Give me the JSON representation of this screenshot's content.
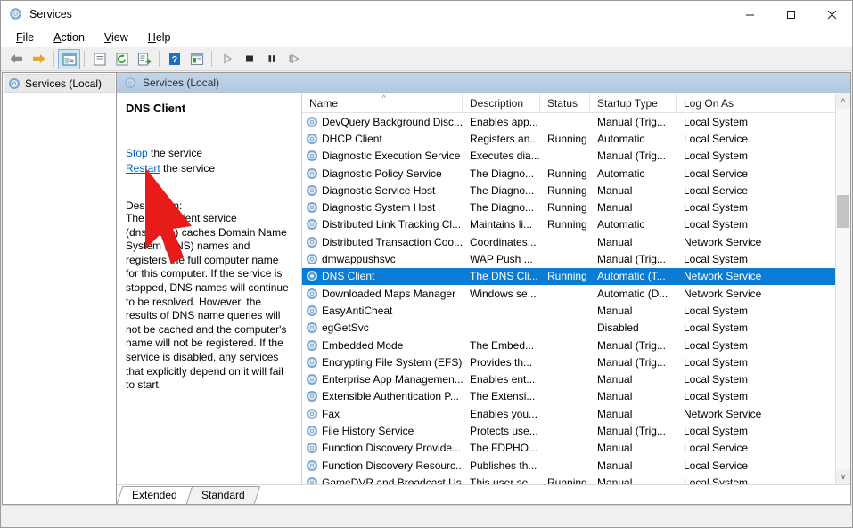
{
  "window": {
    "title": "Services",
    "icon": "services-gear-icon",
    "controls": {
      "minimize": "—",
      "maximize": "☐",
      "close": "✕"
    }
  },
  "menubar": [
    {
      "name": "file",
      "label": "File",
      "accel": "F"
    },
    {
      "name": "action",
      "label": "Action",
      "accel": "A"
    },
    {
      "name": "view",
      "label": "View",
      "accel": "V"
    },
    {
      "name": "help",
      "label": "Help",
      "accel": "H"
    }
  ],
  "toolbar": [
    {
      "name": "back-button",
      "icon": "arrow-left-icon",
      "active": false
    },
    {
      "name": "forward-button",
      "icon": "arrow-right-icon",
      "active": false
    },
    {
      "name": "show-hide-tree-button",
      "icon": "tree-panel-icon",
      "active": true
    },
    {
      "name": "properties-button",
      "icon": "properties-icon",
      "active": false
    },
    {
      "name": "refresh-button",
      "icon": "refresh-icon",
      "active": false
    },
    {
      "name": "export-list-button",
      "icon": "export-icon",
      "active": false
    },
    {
      "name": "help-button",
      "icon": "help-question-icon",
      "active": false
    },
    {
      "name": "console-view-button",
      "icon": "console-view-icon",
      "active": false
    },
    {
      "name": "start-service-button",
      "icon": "play-icon",
      "active": false
    },
    {
      "name": "stop-service-button",
      "icon": "stop-icon",
      "active": false
    },
    {
      "name": "pause-service-button",
      "icon": "pause-icon",
      "active": false
    },
    {
      "name": "restart-service-button",
      "icon": "restart-icon",
      "active": false
    }
  ],
  "tree": {
    "items": [
      {
        "name": "services-local",
        "label": "Services (Local)",
        "icon": "services-gear-icon",
        "selected": true
      }
    ]
  },
  "pane": {
    "header_label": "Services (Local)",
    "header_icon": "services-gear-icon"
  },
  "details": {
    "service_name": "DNS Client",
    "links": [
      {
        "name": "stop-service-link",
        "link_text": "Stop",
        "suffix": " the service"
      },
      {
        "name": "restart-service-link",
        "link_text": "Restart",
        "suffix": " the service"
      }
    ],
    "description_label": "Description:",
    "description_body": "The DNS Client service (dnscache) caches Domain Name System (DNS) names and registers the full computer name for this computer. If the service is stopped, DNS names will continue to be resolved. However, the results of DNS name queries will not be cached and the computer's name will not be registered. If the service is disabled, any services that explicitly depend on it will fail to start."
  },
  "list": {
    "columns": [
      {
        "name": "column-name",
        "label": "Name",
        "sorted": "asc"
      },
      {
        "name": "column-description",
        "label": "Description",
        "sorted": ""
      },
      {
        "name": "column-status",
        "label": "Status",
        "sorted": ""
      },
      {
        "name": "column-startup-type",
        "label": "Startup Type",
        "sorted": ""
      },
      {
        "name": "column-log-on-as",
        "label": "Log On As",
        "sorted": ""
      }
    ],
    "sort_arrow": "^",
    "rows": [
      {
        "name": "DevQuery Background Disc...",
        "description": "Enables app...",
        "status": "",
        "startup": "Manual (Trig...",
        "logon": "Local System",
        "selected": false
      },
      {
        "name": "DHCP Client",
        "description": "Registers an...",
        "status": "Running",
        "startup": "Automatic",
        "logon": "Local Service",
        "selected": false
      },
      {
        "name": "Diagnostic Execution Service",
        "description": "Executes dia...",
        "status": "",
        "startup": "Manual (Trig...",
        "logon": "Local System",
        "selected": false
      },
      {
        "name": "Diagnostic Policy Service",
        "description": "The Diagno...",
        "status": "Running",
        "startup": "Automatic",
        "logon": "Local Service",
        "selected": false
      },
      {
        "name": "Diagnostic Service Host",
        "description": "The Diagno...",
        "status": "Running",
        "startup": "Manual",
        "logon": "Local Service",
        "selected": false
      },
      {
        "name": "Diagnostic System Host",
        "description": "The Diagno...",
        "status": "Running",
        "startup": "Manual",
        "logon": "Local System",
        "selected": false
      },
      {
        "name": "Distributed Link Tracking Cl...",
        "description": "Maintains li...",
        "status": "Running",
        "startup": "Automatic",
        "logon": "Local System",
        "selected": false
      },
      {
        "name": "Distributed Transaction Coo...",
        "description": "Coordinates...",
        "status": "",
        "startup": "Manual",
        "logon": "Network Service",
        "selected": false
      },
      {
        "name": "dmwappushsvc",
        "description": "WAP Push ...",
        "status": "",
        "startup": "Manual (Trig...",
        "logon": "Local System",
        "selected": false
      },
      {
        "name": "DNS Client",
        "description": "The DNS Cli...",
        "status": "Running",
        "startup": "Automatic (T...",
        "logon": "Network Service",
        "selected": true
      },
      {
        "name": "Downloaded Maps Manager",
        "description": "Windows se...",
        "status": "",
        "startup": "Automatic (D...",
        "logon": "Network Service",
        "selected": false
      },
      {
        "name": "EasyAntiCheat",
        "description": "",
        "status": "",
        "startup": "Manual",
        "logon": "Local System",
        "selected": false
      },
      {
        "name": "egGetSvc",
        "description": "",
        "status": "",
        "startup": "Disabled",
        "logon": "Local System",
        "selected": false
      },
      {
        "name": "Embedded Mode",
        "description": "The Embed...",
        "status": "",
        "startup": "Manual (Trig...",
        "logon": "Local System",
        "selected": false
      },
      {
        "name": "Encrypting File System (EFS)",
        "description": "Provides th...",
        "status": "",
        "startup": "Manual (Trig...",
        "logon": "Local System",
        "selected": false
      },
      {
        "name": "Enterprise App Managemen...",
        "description": "Enables ent...",
        "status": "",
        "startup": "Manual",
        "logon": "Local System",
        "selected": false
      },
      {
        "name": "Extensible Authentication P...",
        "description": "The Extensi...",
        "status": "",
        "startup": "Manual",
        "logon": "Local System",
        "selected": false
      },
      {
        "name": "Fax",
        "description": "Enables you...",
        "status": "",
        "startup": "Manual",
        "logon": "Network Service",
        "selected": false
      },
      {
        "name": "File History Service",
        "description": "Protects use...",
        "status": "",
        "startup": "Manual (Trig...",
        "logon": "Local System",
        "selected": false
      },
      {
        "name": "Function Discovery Provide...",
        "description": "The FDPHO...",
        "status": "",
        "startup": "Manual",
        "logon": "Local Service",
        "selected": false
      },
      {
        "name": "Function Discovery Resourc...",
        "description": "Publishes th...",
        "status": "",
        "startup": "Manual",
        "logon": "Local Service",
        "selected": false
      },
      {
        "name": "GameDVR and Broadcast Us...",
        "description": "This user se...",
        "status": "Running",
        "startup": "Manual",
        "logon": "Local System",
        "selected": false
      }
    ]
  },
  "scrollbar": {
    "up_arrow": "^",
    "down_arrow": "∨"
  },
  "tabs": [
    {
      "name": "tab-extended",
      "label": "Extended",
      "active": true
    },
    {
      "name": "tab-standard",
      "label": "Standard",
      "active": false
    }
  ],
  "colors": {
    "selection_blue": "#0a7cd4",
    "pane_header_blue": "#b8cce4",
    "link_blue": "#0066cc",
    "cursor_red": "#e81b1b",
    "toolbar_active": "#cce8f4"
  }
}
